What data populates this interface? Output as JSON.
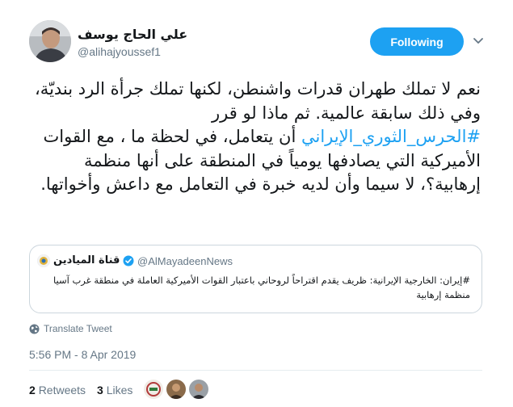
{
  "author": {
    "name": "علي الحاج يوسف",
    "handle": "@alihajyoussef1",
    "avatar_icon": "profile-photo"
  },
  "follow_button": {
    "label": "Following",
    "color": "#1da1f2"
  },
  "tweet": {
    "line1": "نعم لا تملك طهران قدرات واشنطن، لكنها تملك جرأة الرد بنديّة، وفي ذلك سابقة عالمية. ثم ماذا لو قرر",
    "hashtag": "#الحرس_الثوري_الإيراني",
    "line2": " أن يتعامل، في لحظة ما ، مع القوات الأميركية التي يصادفها يومياً في المنطقة على أنها منظمة إرهابية؟، لا سيما وأن لديه خبرة في التعامل مع داعش وأخواتها."
  },
  "quoted_tweet": {
    "name": "قناة الميادين",
    "handle": "@AlMayadeenNews",
    "text": "#إيران: الخارجية الإيرانية: ظريف يقدم اقتراحاً لروحاني باعتبار القوات الأميركية العاملة في منطقة غرب آسيا منظمة إرهابية"
  },
  "translate_label": "Translate Tweet",
  "timestamp": "5:56 PM - 8 Apr 2019",
  "stats": {
    "retweets_count": "2",
    "retweets_label": "Retweets",
    "likes_count": "3",
    "likes_label": "Likes"
  }
}
